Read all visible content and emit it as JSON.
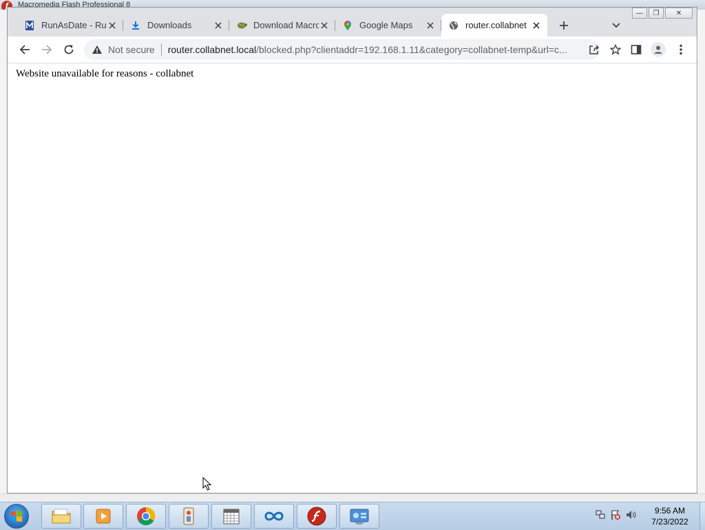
{
  "background_app": {
    "title": "Macromedia Flash Professional 8"
  },
  "browser": {
    "tabs": [
      {
        "title": "RunAsDate - Run",
        "icon": "runasdate-icon"
      },
      {
        "title": "Downloads",
        "icon": "download-icon"
      },
      {
        "title": "Download Macromedia",
        "icon": "turtle-icon"
      },
      {
        "title": "Google Maps",
        "icon": "maps-pin-icon"
      },
      {
        "title": "router.collabnet",
        "icon": "globe-icon",
        "active": true
      }
    ],
    "security_label": "Not secure",
    "url_host": "router.collabnet.local",
    "url_path": "/blocked.php?clientaddr=192.168.1.11&category=collabnet-temp&url=c...",
    "page_message": "Website unavailable for reasons - collabnet"
  },
  "taskbar": {
    "apps": [
      "file-explorer",
      "media-player",
      "chrome",
      "paint",
      "calendar",
      "arduino",
      "flash",
      "control-panel"
    ],
    "time": "9:56 AM",
    "date": "7/23/2022"
  },
  "colors": {
    "tabstrip": "#dfe1e5",
    "omnibox": "#f1f3f4",
    "taskbar": "#c9dbee"
  }
}
